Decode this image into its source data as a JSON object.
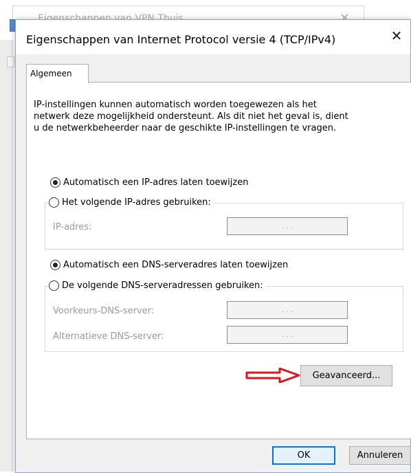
{
  "background_window": {
    "title": "Eigenschappen van VPN Thuis",
    "close_glyph": "✕"
  },
  "dialog": {
    "title": "Eigenschappen van Internet Protocol versie 4 (TCP/IPv4)",
    "close_glyph": "✕",
    "tabs": [
      {
        "label": "Algemeen",
        "active": true
      }
    ],
    "intro_lines": [
      "IP-instellingen kunnen automatisch worden toegewezen als het",
      "netwerk deze mogelijkheid ondersteunt. Als dit niet het geval is, dient",
      "u de netwerkbeheerder naar de geschikte IP-instellingen te vragen."
    ],
    "ip_options": {
      "auto_label": "Automatisch een IP-adres laten toewijzen",
      "auto_selected": true,
      "manual_label": "Het volgende IP-adres gebruiken:",
      "manual_selected": false,
      "fields": [
        {
          "label": "IP-adres:",
          "value": ".   .   ."
        }
      ]
    },
    "dns_options": {
      "auto_label": "Automatisch een DNS-serveradres laten toewijzen",
      "auto_selected": true,
      "manual_label": "De volgende DNS-serveradressen gebruiken:",
      "manual_selected": false,
      "fields": [
        {
          "label": "Voorkeurs-DNS-server:",
          "value": ".   .   ."
        },
        {
          "label": "Alternatieve DNS-server:",
          "value": ".   .   ."
        }
      ]
    },
    "advanced_label": "Geavanceerd...",
    "ok_label": "OK",
    "cancel_label": "Annuleren"
  },
  "colors": {
    "arrow": "#e0141a",
    "ok_border": "#0078d7",
    "dialog_bg": "#f0f0f0"
  }
}
